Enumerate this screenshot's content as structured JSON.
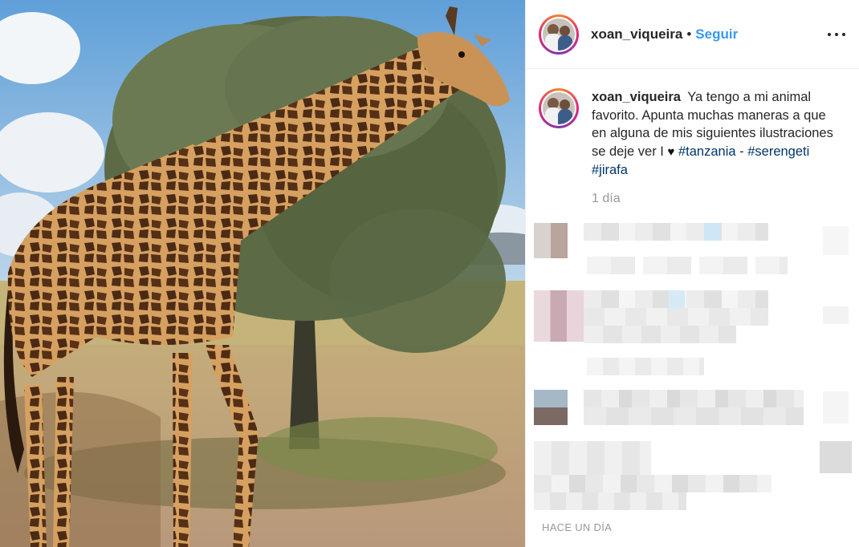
{
  "post": {
    "username": "xoan_viqueira",
    "separator": "•",
    "follow_label": "Seguir",
    "caption": {
      "username": "xoan_viqueira",
      "text_part1": "Ya tengo a mi animal favorito. Apunta muchas maneras a que en alguna de mis siguientes ilustraciones se deje ver I",
      "heart": "♥",
      "hashtag1": "#tanzania",
      "dash": " - ",
      "hashtag2": "#serengeti",
      "hashtag3": "#jirafa",
      "relative_time": "1 día"
    },
    "timestamp": "HACE UN DÍA"
  },
  "colors": {
    "follow_blue": "#3897f0",
    "hashtag_blue": "#003569",
    "muted_gray": "#999999"
  },
  "icons": {
    "more": "more-options-icon",
    "heart": "heart-icon"
  }
}
